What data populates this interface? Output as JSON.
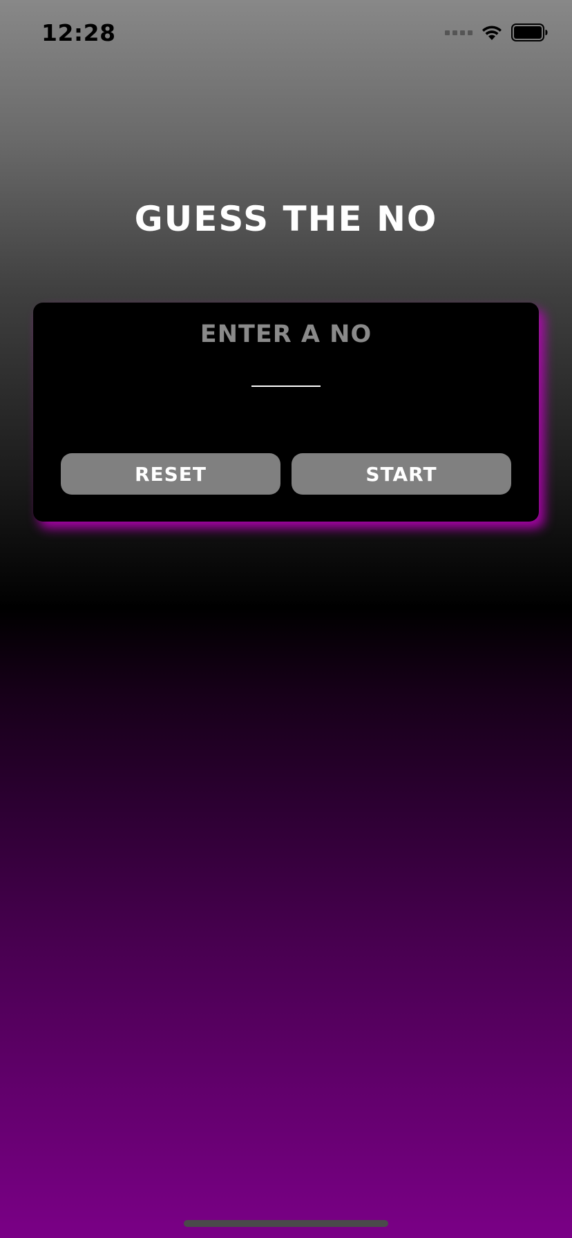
{
  "status_bar": {
    "time": "12:28"
  },
  "app": {
    "title": "GUESS THE NO"
  },
  "guess_card": {
    "label": "ENTER A NO",
    "input_value": "",
    "reset_label": "RESET",
    "start_label": "START"
  },
  "colors": {
    "card_background": "#000000",
    "card_shadow": "#be00be",
    "button_background": "#808080",
    "label_text": "#8a8a8a",
    "gradient_bottom": "#7a0086"
  },
  "icons": {
    "signal": "cellular-signal-icon",
    "wifi": "wifi-icon",
    "battery": "battery-icon"
  }
}
